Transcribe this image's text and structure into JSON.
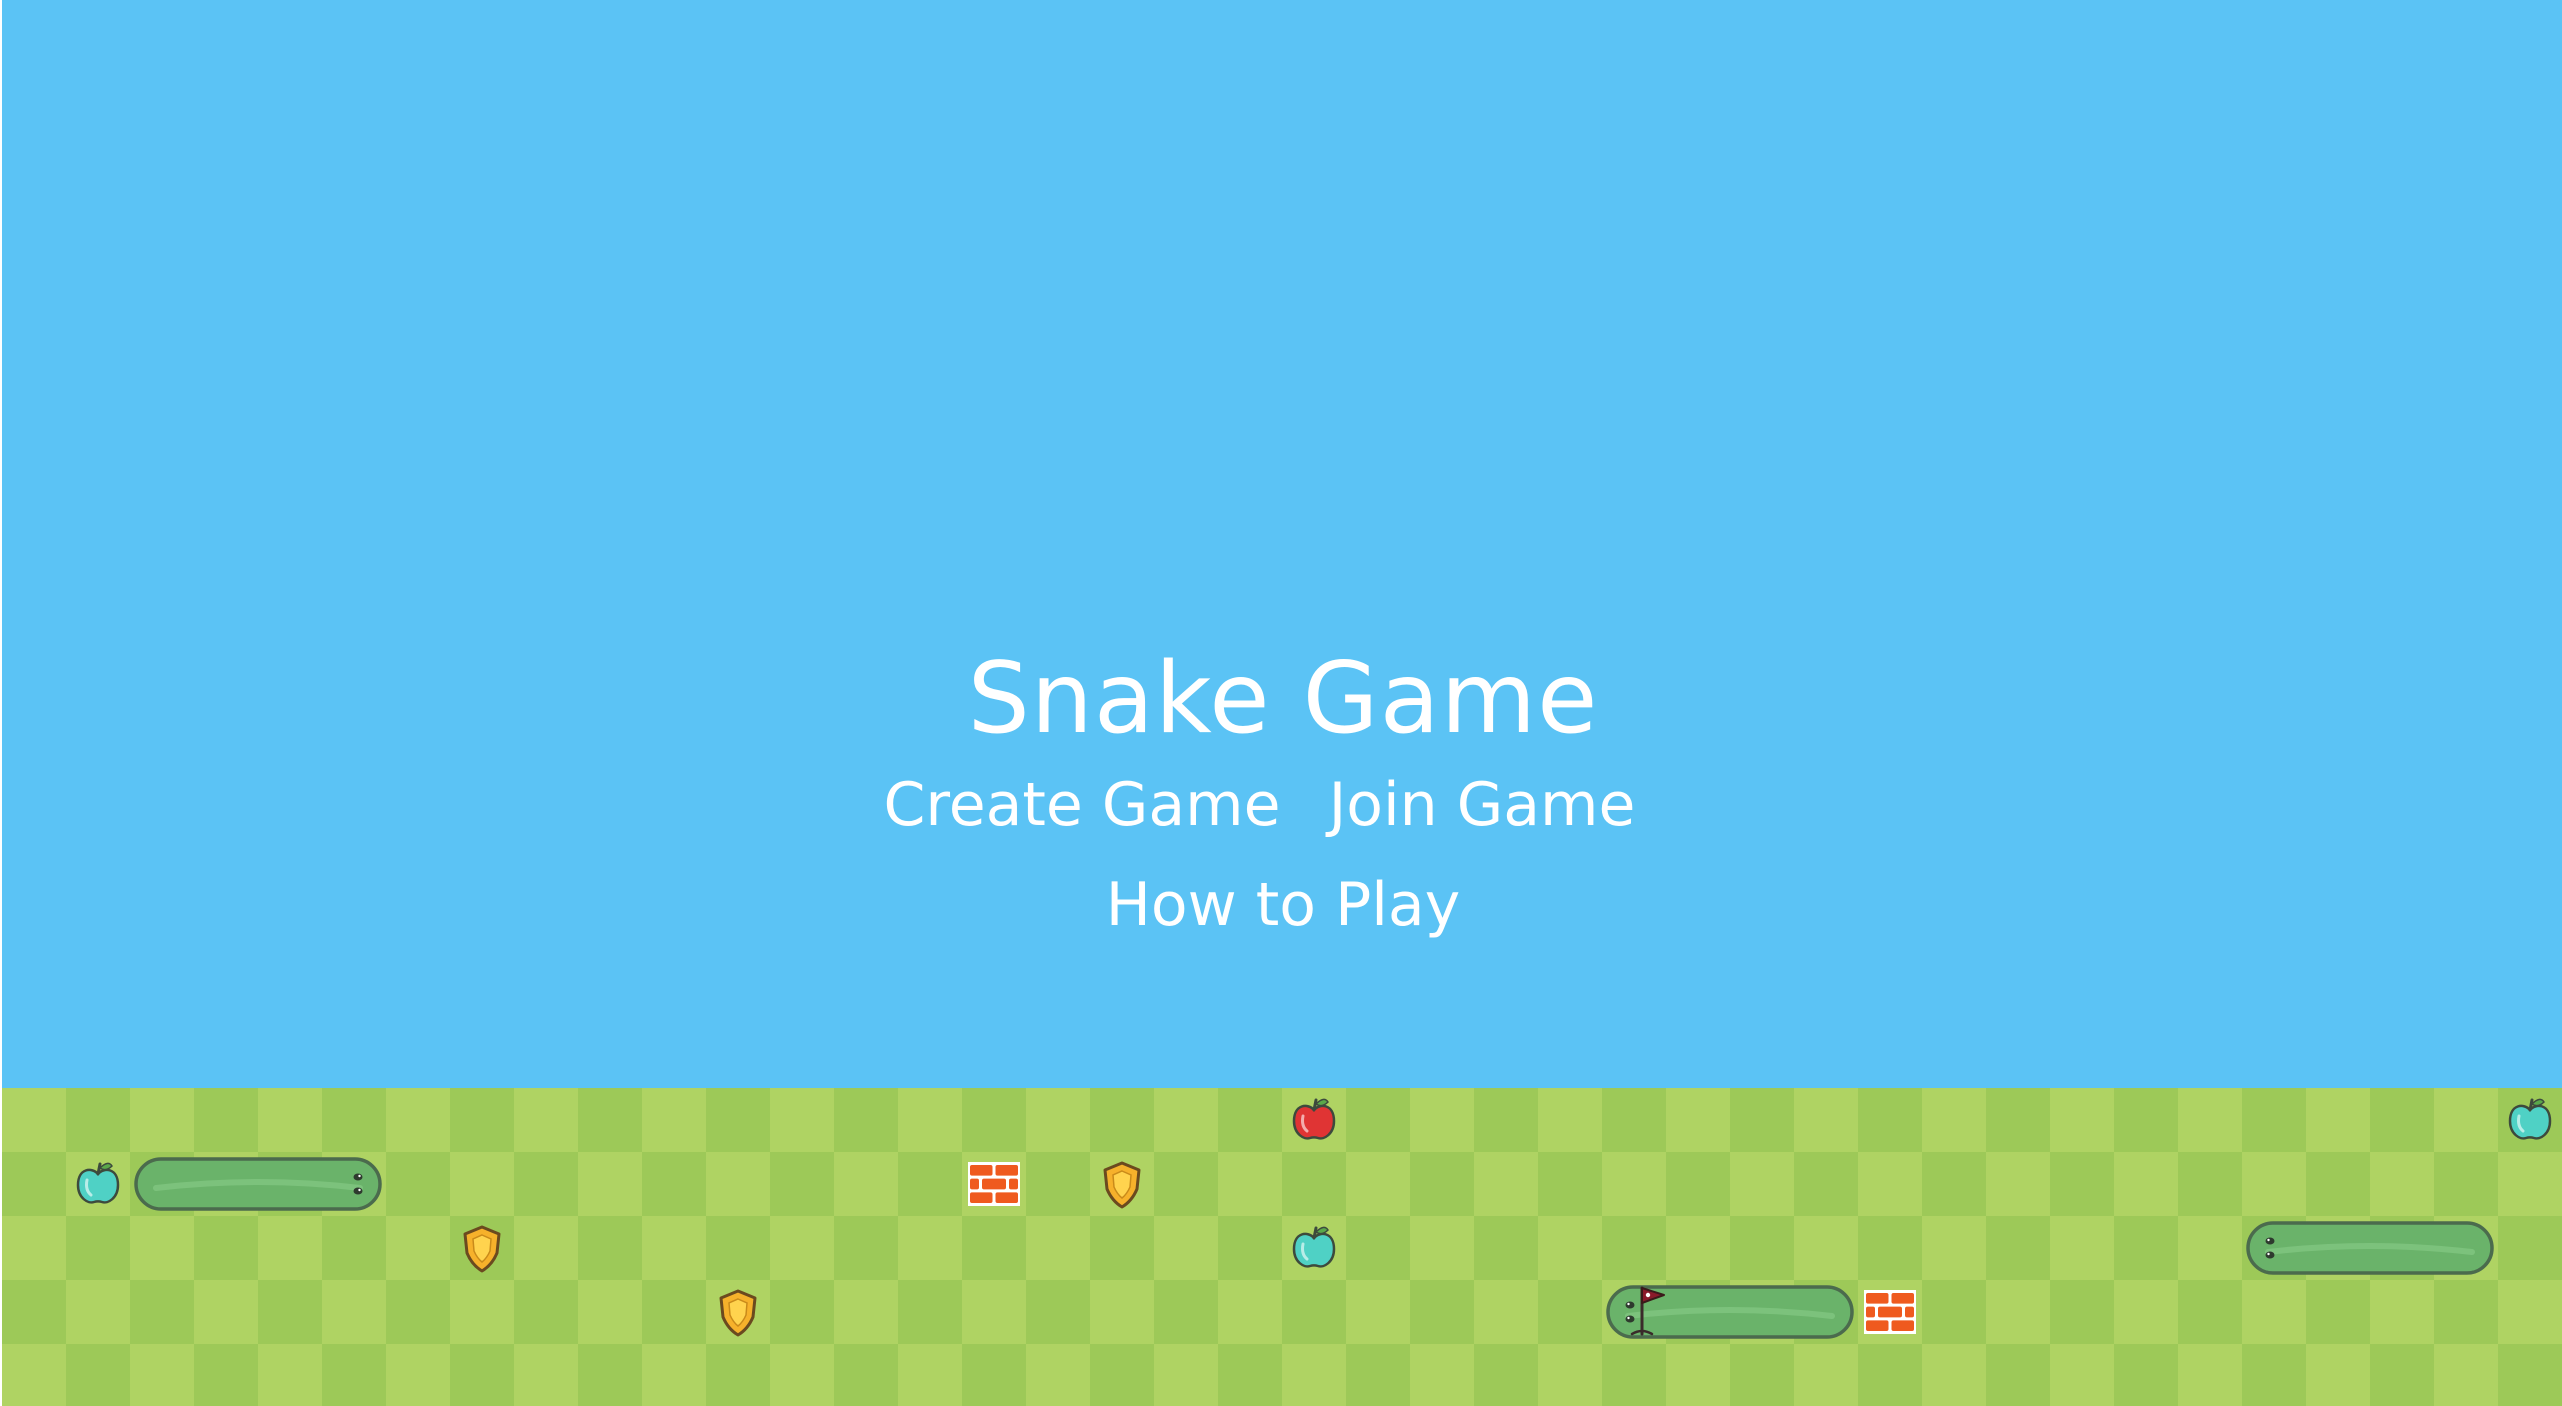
{
  "menu": {
    "title": "Snake Game",
    "create_label": "Create Game",
    "join_label": "Join Game",
    "howto_label": "How to Play"
  },
  "colors": {
    "sky": "#5bc3f5",
    "grass_light": "#afd363",
    "grass_dark": "#9dc958",
    "snake_body": "#6ab36a",
    "snake_outline": "#4b6b4d",
    "apple_red": "#e03434",
    "apple_teal": "#4fd1c5",
    "shield": "#f6b12b",
    "brick": "#ef5a1f"
  },
  "field": {
    "cols": 40,
    "rows": 5,
    "items": [
      {
        "name": "apple-teal-icon",
        "type": "apple-teal",
        "col": 1,
        "row": 1
      },
      {
        "name": "apple-red-icon",
        "type": "apple-red",
        "col": 20,
        "row": 0
      },
      {
        "name": "apple-teal-icon",
        "type": "apple-teal",
        "col": 20,
        "row": 2
      },
      {
        "name": "apple-teal-icon",
        "type": "apple-teal",
        "col": 39,
        "row": 0
      },
      {
        "name": "shield-icon",
        "type": "shield",
        "col": 7,
        "row": 2
      },
      {
        "name": "shield-icon",
        "type": "shield",
        "col": 11,
        "row": 3
      },
      {
        "name": "shield-icon",
        "type": "shield",
        "col": 17,
        "row": 1
      },
      {
        "name": "brick-wall-icon",
        "type": "brick",
        "col": 15,
        "row": 1
      },
      {
        "name": "brick-wall-icon",
        "type": "brick",
        "col": 29,
        "row": 3
      }
    ],
    "snakes": [
      {
        "name": "snake",
        "row": 1,
        "tail_col": 2,
        "head_col": 5,
        "facing": "right",
        "flag": false
      },
      {
        "name": "snake",
        "row": 3,
        "tail_col": 28,
        "head_col": 25,
        "facing": "left",
        "flag": true
      },
      {
        "name": "snake",
        "row": 2,
        "tail_col": 38,
        "head_col": 35,
        "facing": "left",
        "flag": false
      }
    ]
  }
}
